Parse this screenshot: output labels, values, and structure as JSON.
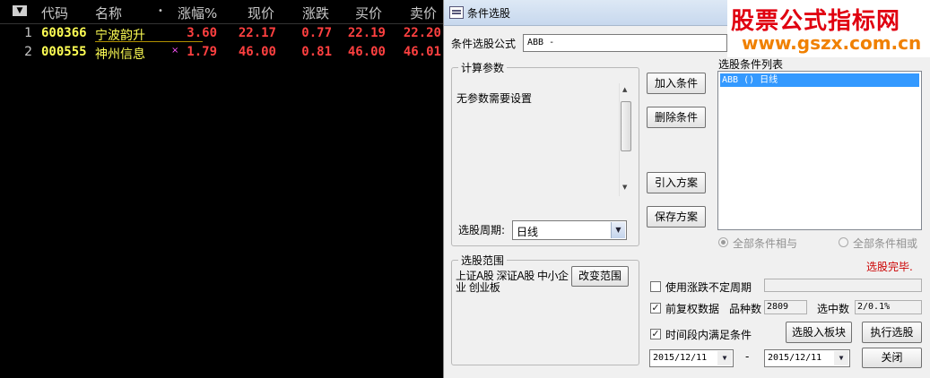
{
  "table": {
    "headers": {
      "sort_arrow": "▼",
      "code": "代码",
      "name": "名称",
      "dot": "•",
      "change_pct": "涨幅%",
      "price": "现价",
      "change": "涨跌",
      "bid": "买价",
      "ask": "卖价"
    },
    "rows": [
      {
        "idx": "1",
        "code": "600366",
        "name": "宁波韵升",
        "mark": "",
        "change_pct": "3.60",
        "price": "22.17",
        "change": "0.77",
        "bid": "22.19",
        "ask": "22.20"
      },
      {
        "idx": "2",
        "code": "000555",
        "name": "神州信息",
        "mark": "×",
        "change_pct": "1.79",
        "price": "46.00",
        "change": "0.81",
        "bid": "46.00",
        "ask": "46.01"
      }
    ]
  },
  "dialog": {
    "title": "条件选股",
    "watermark": {
      "line1": "股票公式指标网",
      "line2": "www.gszx.com.cn"
    },
    "formula_label": "条件选股公式",
    "formula_value": "ABB      -",
    "params_group": "计算参数",
    "params_text": "无参数需要设置",
    "period_label": "选股周期:",
    "period_value": "日线",
    "add_button": "加入条件",
    "delete_button": "删除条件",
    "import_button": "引入方案",
    "save_button": "保存方案",
    "conditions_label": "选股条件列表",
    "conditions": [
      "ABB  () 日线"
    ],
    "radio_and": "全部条件相与",
    "radio_or": "全部条件相或",
    "status": "选股完毕.",
    "scope_group": "选股范围",
    "scope_text": "上证A股 深证A股 中小企业 创业板",
    "change_scope_button": "改变范围",
    "use_undefined_period": "使用涨跌不定周期",
    "prior_adjust": "前复权数据",
    "variety_count_label": "品种数",
    "variety_count": "2809",
    "selected_count_label": "选中数",
    "selected_count": "2/0.1%",
    "within_period": "时间段内满足条件",
    "to_block_button": "选股入板块",
    "execute_button": "执行选股",
    "close_button": "关闭",
    "date_from": "2015/12/11",
    "date_sep": "-",
    "date_to": "2015/12/11"
  },
  "colors": {
    "code_name": "#ffff54",
    "numbers": "#ff4040",
    "header": "#c8c8c8",
    "selection": "#3399ff",
    "status": "#cc0000",
    "watermark_red": "#e00010",
    "watermark_orange": "#f08000"
  }
}
